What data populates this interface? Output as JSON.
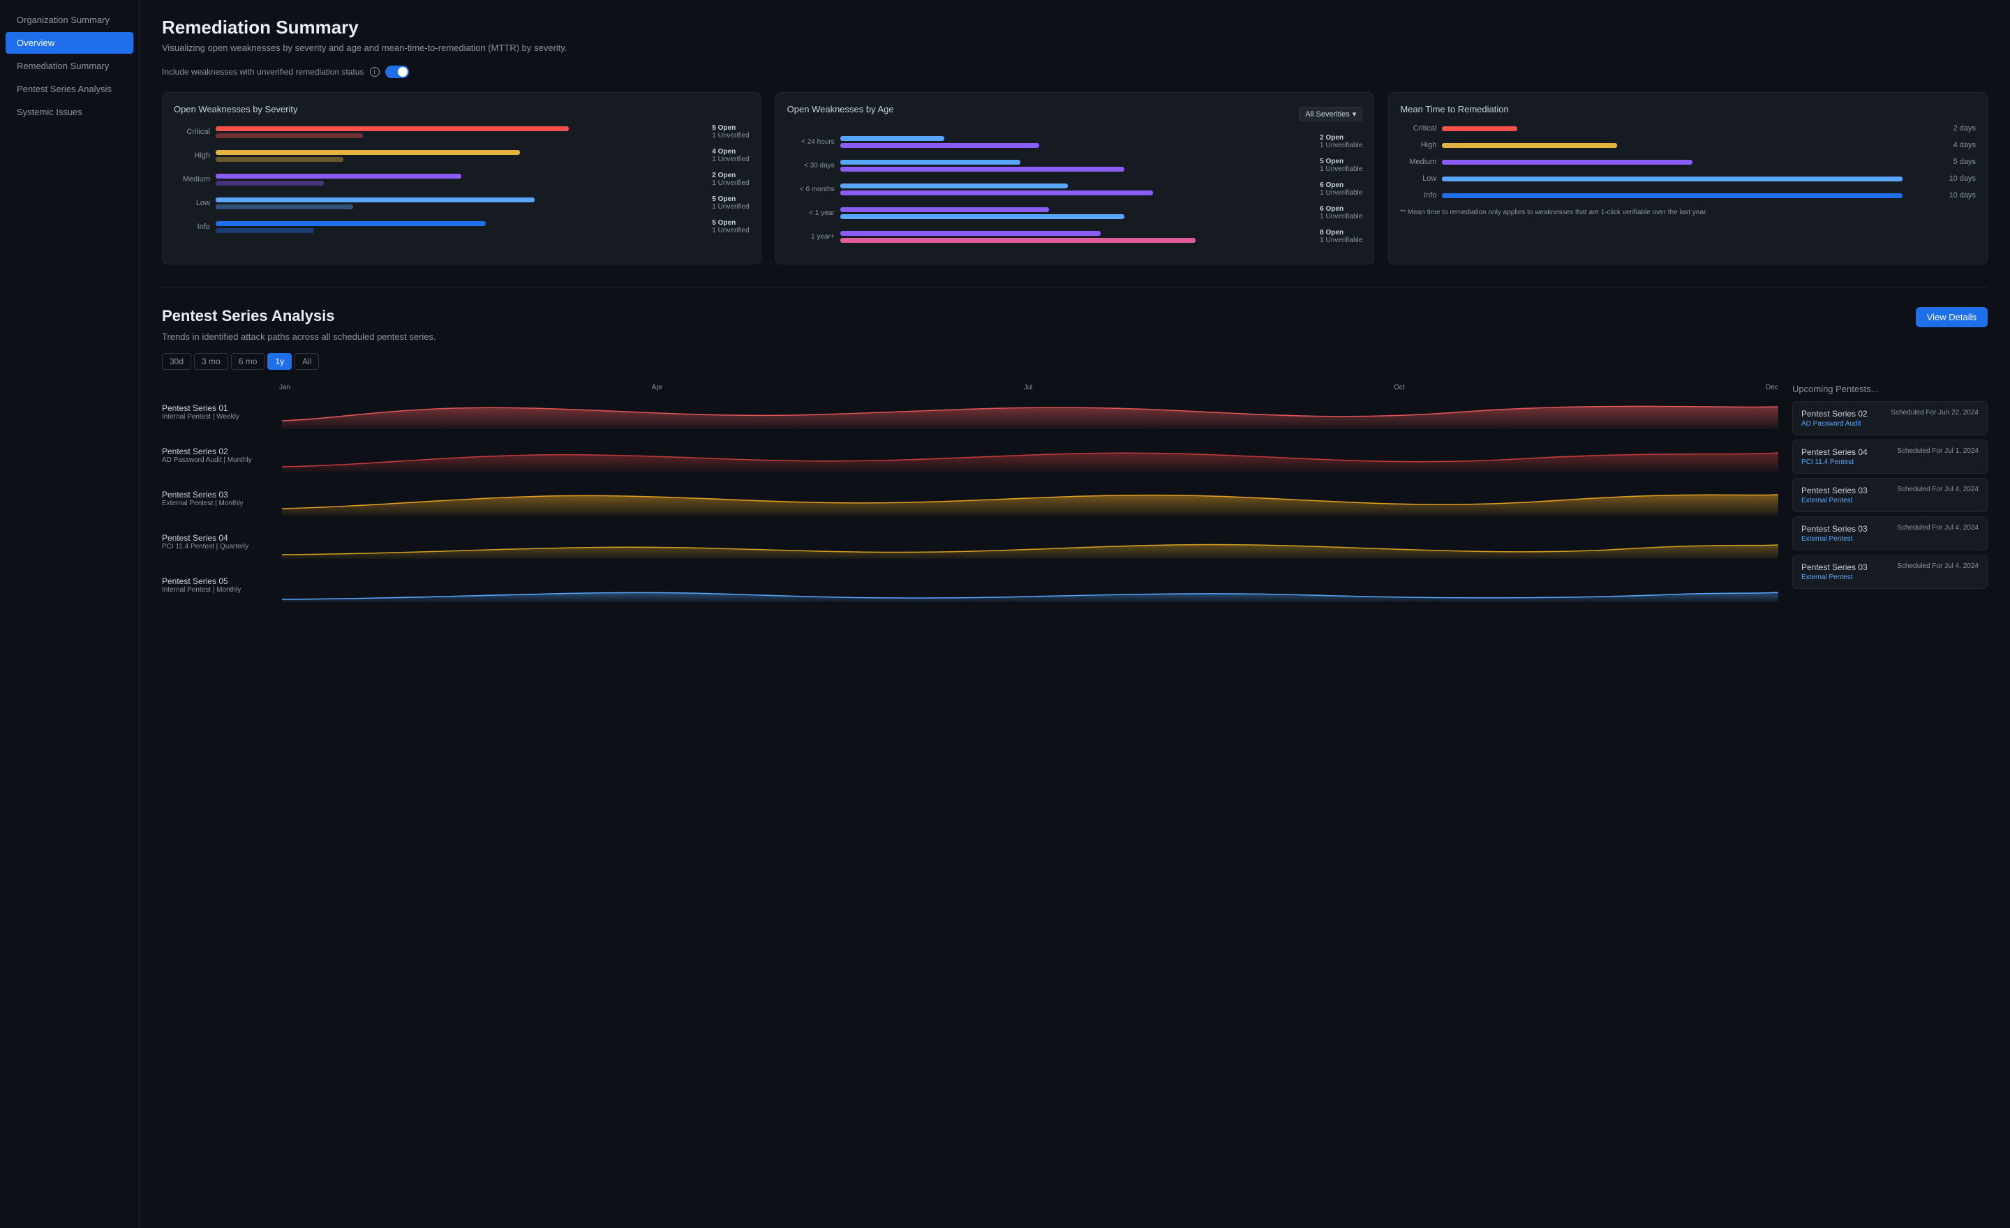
{
  "sidebar": {
    "items": [
      {
        "label": "Organization Summary",
        "active": false,
        "id": "org-summary"
      },
      {
        "label": "Overview",
        "active": true,
        "id": "overview"
      },
      {
        "label": "Remediation Summary",
        "active": false,
        "id": "remediation"
      },
      {
        "label": "Pentest Series Analysis",
        "active": false,
        "id": "pentest-analysis"
      },
      {
        "label": "Systemic Issues",
        "active": false,
        "id": "systemic-issues"
      }
    ]
  },
  "remediation": {
    "title": "Remediation Summary",
    "subtitle": "Visualizing open weaknesses by severity and age and mean-time-to-remediation (MTTR) by severity.",
    "toggle_label": "Include weaknesses with unverified remediation status",
    "open_weaknesses": {
      "title": "Open Weaknesses by Severity",
      "rows": [
        {
          "label": "Critical",
          "color": "critical",
          "bar_width": "70%",
          "unverified_width": "30%",
          "open": "5 Open",
          "unverified": "1 Unverified"
        },
        {
          "label": "High",
          "color": "high",
          "bar_width": "65%",
          "unverified_width": "25%",
          "open": "4 Open",
          "unverified": "1 Unverified"
        },
        {
          "label": "Medium",
          "color": "medium",
          "bar_width": "55%",
          "unverified_width": "22%",
          "open": "2 Open",
          "unverified": "1 Unverified"
        },
        {
          "label": "Low",
          "color": "low",
          "bar_width": "60%",
          "unverified_width": "20%",
          "open": "5 Open",
          "unverified": "1 Unverified"
        },
        {
          "label": "Info",
          "color": "info",
          "bar_width": "50%",
          "unverified_width": "18%",
          "open": "5 Open",
          "unverified": "1 Unverified"
        }
      ]
    },
    "by_age": {
      "title": "Open Weaknesses by Age",
      "dropdown": "All Severities",
      "rows": [
        {
          "label": "< 24 hours",
          "bar1_width": "20%",
          "bar2_width": "40%",
          "open": "2 Open",
          "unverifiable": "1 Unverifiable"
        },
        {
          "label": "< 30 days",
          "bar1_width": "35%",
          "bar2_width": "55%",
          "open": "5 Open",
          "unverifiable": "1 Unverifiable"
        },
        {
          "label": "< 6 months",
          "bar1_width": "45%",
          "bar2_width": "60%",
          "open": "6 Open",
          "unverifiable": "1 Unverifiable"
        },
        {
          "label": "< 1 year",
          "bar1_width": "40%",
          "bar2_width": "58%",
          "open": "6 Open",
          "unverifiable": "1 Unverifiable"
        },
        {
          "label": "1 year+",
          "bar1_width": "50%",
          "bar2_width": "70%",
          "open": "8 Open",
          "unverifiable": "1 Unverifiable"
        }
      ]
    },
    "mttr": {
      "title": "Mean Time to Remediation",
      "rows": [
        {
          "label": "Critical",
          "color": "critical",
          "width": "15%",
          "days": "2 days"
        },
        {
          "label": "High",
          "color": "high",
          "width": "35%",
          "days": "4 days"
        },
        {
          "label": "Medium",
          "color": "medium",
          "width": "50%",
          "days": "5 days"
        },
        {
          "label": "Low",
          "color": "low",
          "width": "90%",
          "days": "10 days"
        },
        {
          "label": "Info",
          "color": "info",
          "width": "90%",
          "days": "10 days"
        }
      ],
      "note": "** Mean time to remediation only applies to weaknesses that are 1-click verifiable over the last year."
    }
  },
  "pentest": {
    "title": "Pentest Series Analysis",
    "subtitle": "Trends in identified attack paths across all scheduled pentest series.",
    "view_details": "View Details",
    "time_filters": [
      "30d",
      "3 mo",
      "6 mo",
      "1y",
      "All"
    ],
    "active_filter": "1y",
    "axis_labels": [
      "Jan",
      "Apr",
      "Jul",
      "Oct",
      "Dec"
    ],
    "series": [
      {
        "name": "Pentest Series 01",
        "type": "Internal Pentest | Weekly",
        "color": "#e05555",
        "fill": "rgba(200,50,50,0.3)"
      },
      {
        "name": "Pentest Series 02",
        "type": "AD Password Audit | Monthly",
        "color": "#c43b3b",
        "fill": "rgba(180,40,40,0.25)"
      },
      {
        "name": "Pentest Series 03",
        "type": "External Pentest | Monthly",
        "color": "#e3a020",
        "fill": "rgba(220,160,30,0.3)"
      },
      {
        "name": "Pentest Series 04",
        "type": "PCI 11.4 Pentest | Quarterly",
        "color": "#d4a020",
        "fill": "rgba(210,155,25,0.25)"
      },
      {
        "name": "Pentest Series 05",
        "type": "Internal Pentest | Monthly",
        "color": "#58a6ff",
        "fill": "rgba(88,166,255,0.25)"
      }
    ],
    "upcoming": {
      "title": "Upcoming Pentests...",
      "items": [
        {
          "name": "Pentest Series 02",
          "type": "AD Password Audit",
          "date": "Scheduled For Jun 22, 2024"
        },
        {
          "name": "Pentest Series 04",
          "type": "PCI 11.4 Pentest",
          "date": "Scheduled For Jul 1, 2024"
        },
        {
          "name": "Pentest Series 03",
          "type": "External Pentest",
          "date": "Scheduled For Jul 4, 2024"
        },
        {
          "name": "Pentest Series 03",
          "type": "External Pentest",
          "date": "Scheduled For Jul 4, 2024"
        },
        {
          "name": "Pentest Series 03",
          "type": "External Pentest",
          "date": "Scheduled For Jul 4, 2024"
        }
      ]
    }
  }
}
